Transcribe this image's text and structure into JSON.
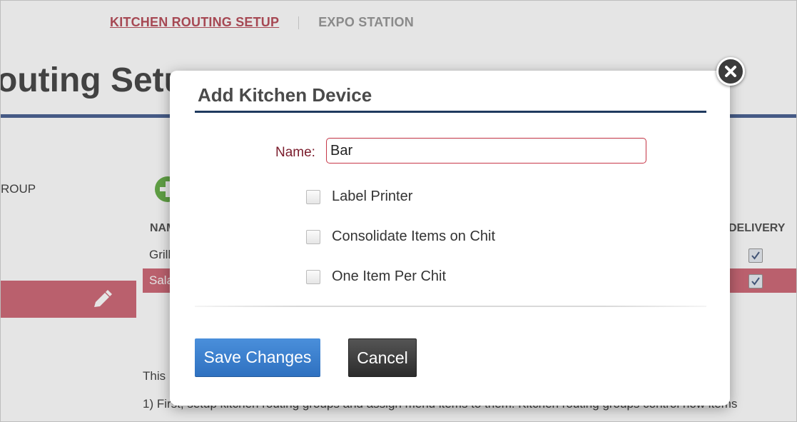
{
  "background_page": {
    "tabs": [
      {
        "label": "KITCHEN ROUTING SETUP",
        "active": true
      },
      {
        "label": "EXPO STATION",
        "active": false
      }
    ],
    "title_fragment": "outing Setup",
    "group_column_fragment": "ROUP",
    "table": {
      "columns": {
        "name": "NAME",
        "delivery": "DELIVERY"
      },
      "rows": [
        {
          "name": "Grill",
          "delivery_checked": true,
          "selected": false
        },
        {
          "name": "Salad",
          "delivery_checked": true,
          "selected": true
        }
      ]
    },
    "help_text": [
      "This",
      "1) First, setup kitchen routing groups and assign menu items to them. Kitchen routing groups control how items"
    ]
  },
  "modal": {
    "title": "Add Kitchen Device",
    "name_label": "Name:",
    "name_value": "Bar",
    "options": [
      {
        "label": "Label Printer",
        "checked": false
      },
      {
        "label": "Consolidate Items on Chit",
        "checked": false
      },
      {
        "label": "One Item Per Chit",
        "checked": false
      }
    ],
    "save_label": "Save Changes",
    "cancel_label": "Cancel",
    "close_icon": "close-icon"
  },
  "colors": {
    "accent_rose": "#b9515d",
    "selected_row": "#d06b7a",
    "save_blue": "#3a7fcf",
    "title_rule": "#1f3a5f"
  }
}
